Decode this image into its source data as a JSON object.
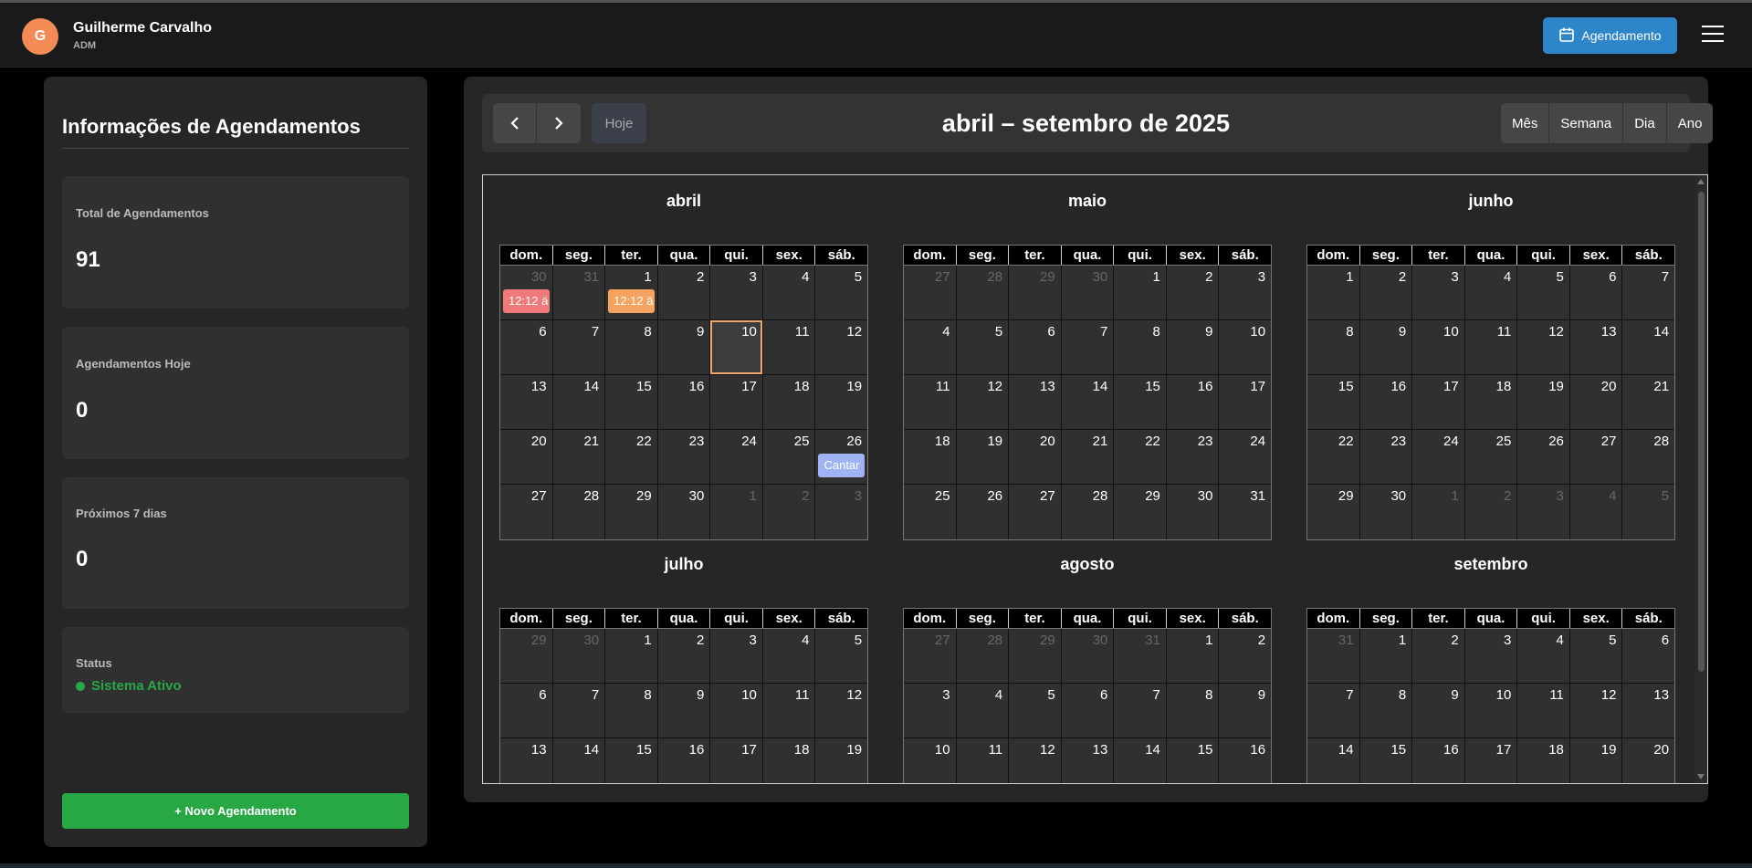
{
  "header": {
    "avatar_initial": "G",
    "user_name": "Guilherme Carvalho",
    "user_role": "ADM",
    "schedule_button": "Agendamento"
  },
  "sidebar": {
    "title": "Informações de Agendamentos",
    "cards": [
      {
        "label": "Total de Agendamentos",
        "value": "91"
      },
      {
        "label": "Agendamentos Hoje",
        "value": "0"
      },
      {
        "label": "Próximos 7 dias",
        "value": "0"
      }
    ],
    "status_label": "Status",
    "status_value": "Sistema Ativo",
    "new_button": "+ Novo Agendamento"
  },
  "calendar": {
    "prev_icon": "chevron-left-icon",
    "next_icon": "chevron-right-icon",
    "today_button": "Hoje",
    "title": "abril – setembro de 2025",
    "views": [
      "Mês",
      "Semana",
      "Dia",
      "Ano"
    ],
    "weekdays": [
      "dom.",
      "seg.",
      "ter.",
      "qua.",
      "qui.",
      "sex.",
      "sáb."
    ],
    "today_date": "2025-04-10",
    "months": [
      {
        "name": "abril",
        "first_weekday": 2,
        "days": 30,
        "prev_days": 31,
        "weeks": 5,
        "visible_weeks": 5
      },
      {
        "name": "maio",
        "first_weekday": 4,
        "days": 31,
        "prev_days": 30,
        "weeks": 5,
        "visible_weeks": 5
      },
      {
        "name": "junho",
        "first_weekday": 0,
        "days": 30,
        "prev_days": 31,
        "weeks": 5,
        "visible_weeks": 5
      },
      {
        "name": "julho",
        "first_weekday": 2,
        "days": 31,
        "prev_days": 30,
        "weeks": 5,
        "visible_weeks": 4
      },
      {
        "name": "agosto",
        "first_weekday": 5,
        "days": 31,
        "prev_days": 31,
        "weeks": 6,
        "visible_weeks": 5
      },
      {
        "name": "setembro",
        "first_weekday": 1,
        "days": 30,
        "prev_days": 31,
        "weeks": 5,
        "visible_weeks": 4
      }
    ],
    "events": [
      {
        "month": 0,
        "week": 0,
        "weekday": 0,
        "label": "12:12 ä",
        "color": "#f07a7a"
      },
      {
        "month": 0,
        "week": 0,
        "weekday": 2,
        "label": "12:12 ä",
        "color": "#f4a460"
      },
      {
        "month": 0,
        "week": 3,
        "weekday": 6,
        "label": "Cantar",
        "color": "#9fb3f5"
      }
    ]
  },
  "colors": {
    "accent_blue": "#2e86c8",
    "success_green": "#28a745",
    "avatar_orange": "#f28b55",
    "today_outline": "#f0a86a"
  }
}
